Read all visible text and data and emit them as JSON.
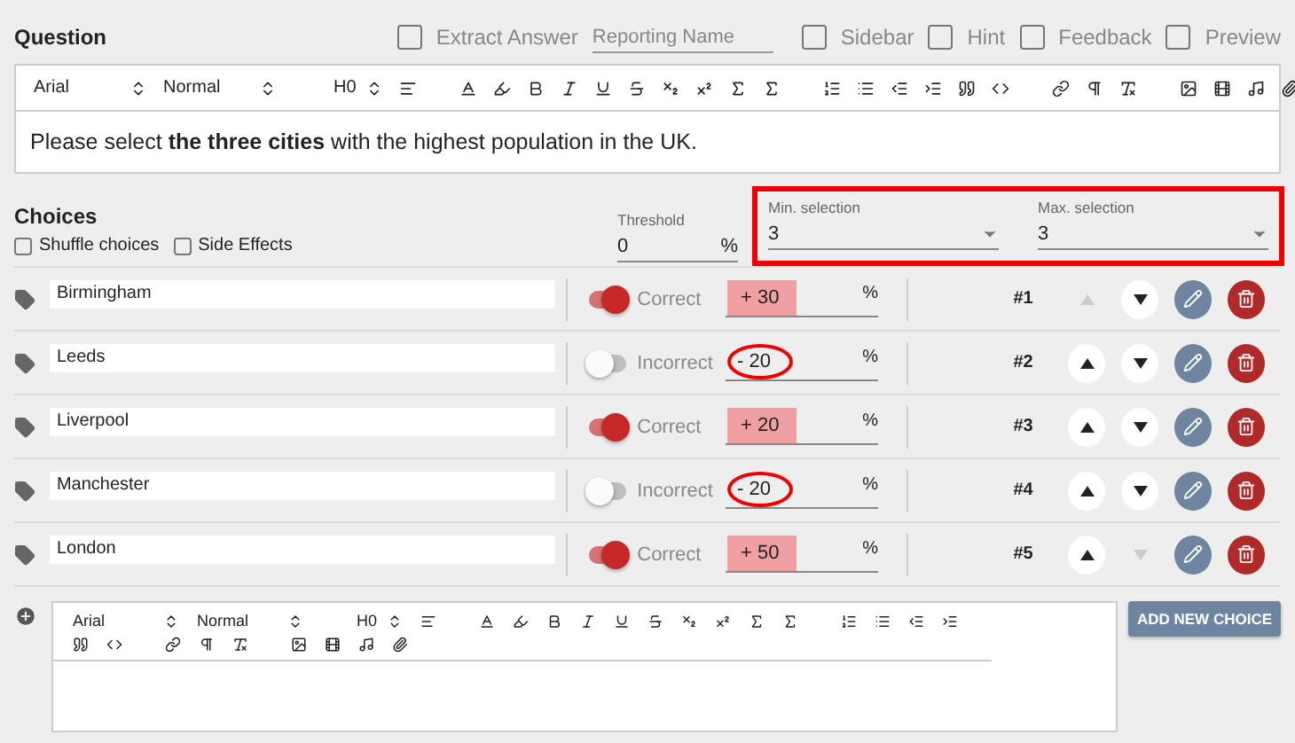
{
  "question": {
    "title": "Question",
    "options": [
      {
        "kind": "checkbox",
        "label": "Extract Answer",
        "checked": false
      },
      {
        "kind": "field",
        "placeholder": "Reporting Name"
      },
      {
        "kind": "checkbox",
        "label": "Sidebar",
        "checked": false
      },
      {
        "kind": "checkbox",
        "label": "Hint",
        "checked": false
      },
      {
        "kind": "checkbox",
        "label": "Feedback",
        "checked": false
      },
      {
        "kind": "checkbox",
        "label": "Preview",
        "checked": false
      }
    ],
    "toolbar": {
      "font": "Arial",
      "size": "Normal",
      "heading": "H0"
    },
    "content": "Please select **the three cities** with the highest population in the UK."
  },
  "choices_section": {
    "title": "Choices",
    "options": [
      {
        "label": "Shuffle choices",
        "checked": false
      },
      {
        "label": "Side Effects",
        "checked": false
      }
    ],
    "threshold": {
      "label": "Threshold",
      "value": "0",
      "unit": "%"
    },
    "selection": {
      "highlighted": true,
      "min": {
        "label": "Min. selection",
        "value": "3"
      },
      "max": {
        "label": "Max. selection",
        "value": "3"
      }
    }
  },
  "choices": [
    {
      "text": "Birmingham",
      "correct": true,
      "status": "Correct",
      "score": "+ 30",
      "score_highlighted": true,
      "score_circled": false,
      "unit": "%",
      "number": "#1",
      "up_disabled": true,
      "down_disabled": false
    },
    {
      "text": "Leeds",
      "correct": false,
      "status": "Incorrect",
      "score": "- 20",
      "score_highlighted": false,
      "score_circled": true,
      "unit": "%",
      "number": "#2",
      "up_disabled": false,
      "down_disabled": false
    },
    {
      "text": "Liverpool",
      "correct": true,
      "status": "Correct",
      "score": "+ 20",
      "score_highlighted": true,
      "score_circled": false,
      "unit": "%",
      "number": "#3",
      "up_disabled": false,
      "down_disabled": false
    },
    {
      "text": "Manchester",
      "correct": false,
      "status": "Incorrect",
      "score": "- 20",
      "score_highlighted": false,
      "score_circled": true,
      "unit": "%",
      "number": "#4",
      "up_disabled": false,
      "down_disabled": false
    },
    {
      "text": "London",
      "correct": true,
      "status": "Correct",
      "score": "+ 50",
      "score_highlighted": true,
      "score_circled": false,
      "unit": "%",
      "number": "#5",
      "up_disabled": false,
      "down_disabled": true
    }
  ],
  "new_choice": {
    "toolbar": {
      "font": "Arial",
      "size": "Normal",
      "heading": "H0"
    },
    "button": "ADD NEW CHOICE"
  }
}
